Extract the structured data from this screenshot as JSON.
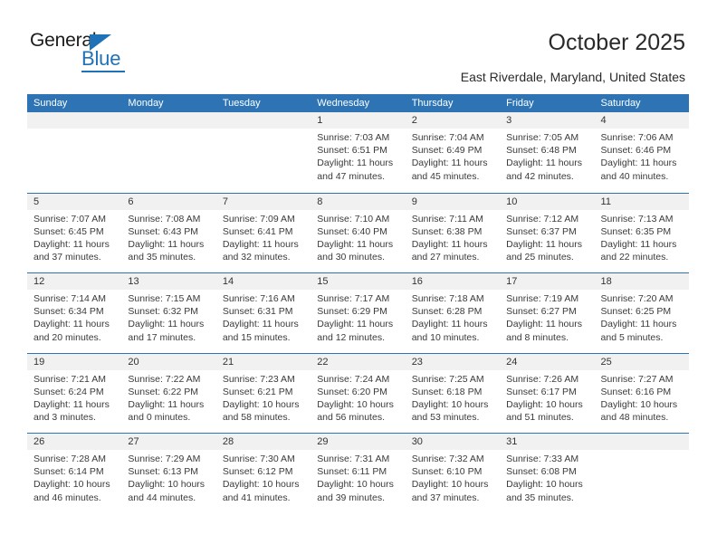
{
  "brand": {
    "name_part1": "General",
    "name_part2": "Blue",
    "triangle_icon": "triangle-icon",
    "accent_color": "#1f72b8"
  },
  "header": {
    "title": "October 2025",
    "subtitle": "East Riverdale, Maryland, United States"
  },
  "calendar": {
    "header_background": "#2e74b5",
    "daynum_band_background": "#f1f1f1",
    "weekdays": [
      "Sunday",
      "Monday",
      "Tuesday",
      "Wednesday",
      "Thursday",
      "Friday",
      "Saturday"
    ],
    "weeks": [
      [
        {
          "day": "",
          "empty": true
        },
        {
          "day": "",
          "empty": true
        },
        {
          "day": "",
          "empty": true
        },
        {
          "day": "1",
          "sunrise": "Sunrise: 7:03 AM",
          "sunset": "Sunset: 6:51 PM",
          "daylight1": "Daylight: 11 hours",
          "daylight2": "and 47 minutes."
        },
        {
          "day": "2",
          "sunrise": "Sunrise: 7:04 AM",
          "sunset": "Sunset: 6:49 PM",
          "daylight1": "Daylight: 11 hours",
          "daylight2": "and 45 minutes."
        },
        {
          "day": "3",
          "sunrise": "Sunrise: 7:05 AM",
          "sunset": "Sunset: 6:48 PM",
          "daylight1": "Daylight: 11 hours",
          "daylight2": "and 42 minutes."
        },
        {
          "day": "4",
          "sunrise": "Sunrise: 7:06 AM",
          "sunset": "Sunset: 6:46 PM",
          "daylight1": "Daylight: 11 hours",
          "daylight2": "and 40 minutes."
        }
      ],
      [
        {
          "day": "5",
          "sunrise": "Sunrise: 7:07 AM",
          "sunset": "Sunset: 6:45 PM",
          "daylight1": "Daylight: 11 hours",
          "daylight2": "and 37 minutes."
        },
        {
          "day": "6",
          "sunrise": "Sunrise: 7:08 AM",
          "sunset": "Sunset: 6:43 PM",
          "daylight1": "Daylight: 11 hours",
          "daylight2": "and 35 minutes."
        },
        {
          "day": "7",
          "sunrise": "Sunrise: 7:09 AM",
          "sunset": "Sunset: 6:41 PM",
          "daylight1": "Daylight: 11 hours",
          "daylight2": "and 32 minutes."
        },
        {
          "day": "8",
          "sunrise": "Sunrise: 7:10 AM",
          "sunset": "Sunset: 6:40 PM",
          "daylight1": "Daylight: 11 hours",
          "daylight2": "and 30 minutes."
        },
        {
          "day": "9",
          "sunrise": "Sunrise: 7:11 AM",
          "sunset": "Sunset: 6:38 PM",
          "daylight1": "Daylight: 11 hours",
          "daylight2": "and 27 minutes."
        },
        {
          "day": "10",
          "sunrise": "Sunrise: 7:12 AM",
          "sunset": "Sunset: 6:37 PM",
          "daylight1": "Daylight: 11 hours",
          "daylight2": "and 25 minutes."
        },
        {
          "day": "11",
          "sunrise": "Sunrise: 7:13 AM",
          "sunset": "Sunset: 6:35 PM",
          "daylight1": "Daylight: 11 hours",
          "daylight2": "and 22 minutes."
        }
      ],
      [
        {
          "day": "12",
          "sunrise": "Sunrise: 7:14 AM",
          "sunset": "Sunset: 6:34 PM",
          "daylight1": "Daylight: 11 hours",
          "daylight2": "and 20 minutes."
        },
        {
          "day": "13",
          "sunrise": "Sunrise: 7:15 AM",
          "sunset": "Sunset: 6:32 PM",
          "daylight1": "Daylight: 11 hours",
          "daylight2": "and 17 minutes."
        },
        {
          "day": "14",
          "sunrise": "Sunrise: 7:16 AM",
          "sunset": "Sunset: 6:31 PM",
          "daylight1": "Daylight: 11 hours",
          "daylight2": "and 15 minutes."
        },
        {
          "day": "15",
          "sunrise": "Sunrise: 7:17 AM",
          "sunset": "Sunset: 6:29 PM",
          "daylight1": "Daylight: 11 hours",
          "daylight2": "and 12 minutes."
        },
        {
          "day": "16",
          "sunrise": "Sunrise: 7:18 AM",
          "sunset": "Sunset: 6:28 PM",
          "daylight1": "Daylight: 11 hours",
          "daylight2": "and 10 minutes."
        },
        {
          "day": "17",
          "sunrise": "Sunrise: 7:19 AM",
          "sunset": "Sunset: 6:27 PM",
          "daylight1": "Daylight: 11 hours",
          "daylight2": "and 8 minutes."
        },
        {
          "day": "18",
          "sunrise": "Sunrise: 7:20 AM",
          "sunset": "Sunset: 6:25 PM",
          "daylight1": "Daylight: 11 hours",
          "daylight2": "and 5 minutes."
        }
      ],
      [
        {
          "day": "19",
          "sunrise": "Sunrise: 7:21 AM",
          "sunset": "Sunset: 6:24 PM",
          "daylight1": "Daylight: 11 hours",
          "daylight2": "and 3 minutes."
        },
        {
          "day": "20",
          "sunrise": "Sunrise: 7:22 AM",
          "sunset": "Sunset: 6:22 PM",
          "daylight1": "Daylight: 11 hours",
          "daylight2": "and 0 minutes."
        },
        {
          "day": "21",
          "sunrise": "Sunrise: 7:23 AM",
          "sunset": "Sunset: 6:21 PM",
          "daylight1": "Daylight: 10 hours",
          "daylight2": "and 58 minutes."
        },
        {
          "day": "22",
          "sunrise": "Sunrise: 7:24 AM",
          "sunset": "Sunset: 6:20 PM",
          "daylight1": "Daylight: 10 hours",
          "daylight2": "and 56 minutes."
        },
        {
          "day": "23",
          "sunrise": "Sunrise: 7:25 AM",
          "sunset": "Sunset: 6:18 PM",
          "daylight1": "Daylight: 10 hours",
          "daylight2": "and 53 minutes."
        },
        {
          "day": "24",
          "sunrise": "Sunrise: 7:26 AM",
          "sunset": "Sunset: 6:17 PM",
          "daylight1": "Daylight: 10 hours",
          "daylight2": "and 51 minutes."
        },
        {
          "day": "25",
          "sunrise": "Sunrise: 7:27 AM",
          "sunset": "Sunset: 6:16 PM",
          "daylight1": "Daylight: 10 hours",
          "daylight2": "and 48 minutes."
        }
      ],
      [
        {
          "day": "26",
          "sunrise": "Sunrise: 7:28 AM",
          "sunset": "Sunset: 6:14 PM",
          "daylight1": "Daylight: 10 hours",
          "daylight2": "and 46 minutes."
        },
        {
          "day": "27",
          "sunrise": "Sunrise: 7:29 AM",
          "sunset": "Sunset: 6:13 PM",
          "daylight1": "Daylight: 10 hours",
          "daylight2": "and 44 minutes."
        },
        {
          "day": "28",
          "sunrise": "Sunrise: 7:30 AM",
          "sunset": "Sunset: 6:12 PM",
          "daylight1": "Daylight: 10 hours",
          "daylight2": "and 41 minutes."
        },
        {
          "day": "29",
          "sunrise": "Sunrise: 7:31 AM",
          "sunset": "Sunset: 6:11 PM",
          "daylight1": "Daylight: 10 hours",
          "daylight2": "and 39 minutes."
        },
        {
          "day": "30",
          "sunrise": "Sunrise: 7:32 AM",
          "sunset": "Sunset: 6:10 PM",
          "daylight1": "Daylight: 10 hours",
          "daylight2": "and 37 minutes."
        },
        {
          "day": "31",
          "sunrise": "Sunrise: 7:33 AM",
          "sunset": "Sunset: 6:08 PM",
          "daylight1": "Daylight: 10 hours",
          "daylight2": "and 35 minutes."
        },
        {
          "day": "",
          "empty": true
        }
      ]
    ]
  }
}
